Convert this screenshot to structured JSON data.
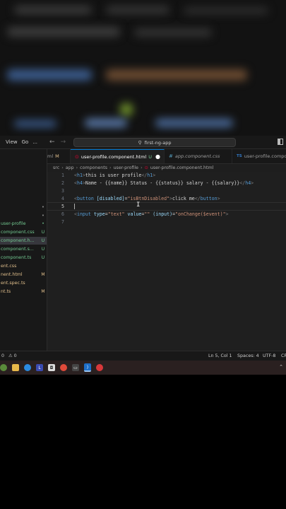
{
  "titlebar": {
    "menus": [
      "View",
      "Go",
      "..."
    ],
    "search": "first-ng-app"
  },
  "sidebar": {
    "items": [
      {
        "label": "",
        "badge": "•",
        "kind": "dot"
      },
      {
        "label": "",
        "badge": "•",
        "kind": "dot"
      },
      {
        "label": "user-profile",
        "badge": "•",
        "kind": "green-dot"
      },
      {
        "label": "component.css",
        "badge": "U",
        "kind": "green"
      },
      {
        "label": "component.h...",
        "badge": "U",
        "kind": "active"
      },
      {
        "label": "component.s...",
        "badge": "U",
        "kind": "green"
      },
      {
        "label": "component.ts",
        "badge": "U",
        "kind": "green"
      },
      {
        "label": "ent.css",
        "badge": "",
        "kind": "mod"
      },
      {
        "label": "nent.html",
        "badge": "M",
        "kind": "mod"
      },
      {
        "label": "ent.spec.ts",
        "badge": "",
        "kind": "mod"
      },
      {
        "label": "nt.ts",
        "badge": "M",
        "kind": "mod"
      }
    ]
  },
  "tabs": [
    {
      "label": "ml",
      "badge": "M"
    },
    {
      "label": "user-profile.component.html",
      "badge": "U"
    },
    {
      "label": "app.component.css",
      "badge": ""
    },
    {
      "label": "user-profile.compo",
      "badge": ""
    }
  ],
  "breadcrumb": [
    "src",
    "app",
    "components",
    "user-profile",
    "user-profile.component.html"
  ],
  "editor": {
    "line_numbers": [
      "1",
      "2",
      "3",
      "4",
      "5",
      "6",
      "7"
    ],
    "line1": {
      "open": "<",
      "tag": "h1",
      "close": ">",
      "text": "this is user profile",
      "end_open": "</",
      "end_tag": "h1",
      "end_close": ">"
    },
    "line2": {
      "open": "<",
      "tag": "h4",
      "close": ">",
      "text": "Name - {{name}} Status - {{status}} salary - {{salary}}",
      "end_open": "</",
      "end_tag": "h4",
      "end_close": ">"
    },
    "line4": {
      "open": "<",
      "tag": "button",
      "attr": "[disabled]",
      "eq": "=",
      "val": "\"isBtnDisabled\"",
      "close": ">",
      "text": "click me",
      "end_open": "</",
      "end_tag": "button",
      "end_close": ">"
    },
    "line6": {
      "open": "<",
      "tag": "input",
      "attr1": "type",
      "eq": "=",
      "val1": "\"text\"",
      "attr2": "value",
      "val2": "\"\"",
      "attr3": "(input)",
      "val3": "\"onChange($event)\"",
      "close": ">"
    }
  },
  "statusbar": {
    "left1": "0",
    "left2": "⚠ 0",
    "position": "Ln 5, Col 1",
    "spaces": "Spaces: 4",
    "encoding": "UTF-8",
    "eol": "CR"
  },
  "colors": {
    "editor_bg": "#1f1f1f",
    "accent": "#0078d4",
    "untracked": "#73c991",
    "modified": "#e2c08d",
    "angular": "#dd0031"
  }
}
